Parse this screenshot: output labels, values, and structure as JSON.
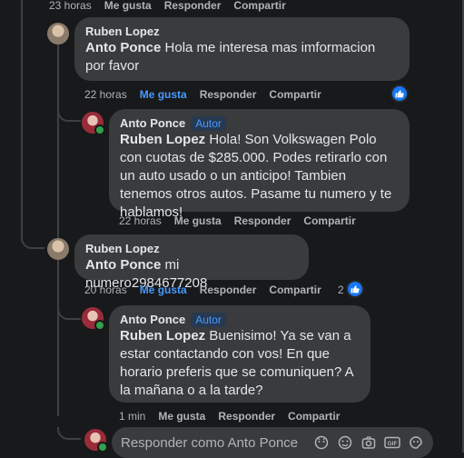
{
  "top_actions": {
    "time": "23 horas",
    "like": "Me gusta",
    "reply": "Responder",
    "share": "Compartir"
  },
  "comments": [
    {
      "author": "Ruben Lopez",
      "mention": "Anto Ponce",
      "text": "Hola me interesa mas imformacion por favor",
      "actions": {
        "time": "22 horas",
        "like": "Me gusta",
        "reply": "Responder",
        "share": "Compartir"
      }
    },
    {
      "author": "Anto Ponce",
      "badge": "Autor",
      "mention": "Ruben Lopez",
      "text": "Hola! Son Volkswagen Polo con cuotas de $285.000. Podes retirarlo con un auto usado o un anticipo! Tambien tenemos otros autos. Pasame tu numero y te hablamos!",
      "actions": {
        "time": "22 horas",
        "like": "Me gusta",
        "reply": "Responder",
        "share": "Compartir"
      }
    },
    {
      "author": "Ruben Lopez",
      "mention": "Anto Ponce",
      "text": "mi numero2984677208",
      "actions": {
        "time": "20 horas",
        "like": "Me gusta",
        "reply": "Responder",
        "share": "Compartir"
      },
      "reactions": "2"
    },
    {
      "author": "Anto Ponce",
      "badge": "Autor",
      "mention": "Ruben Lopez",
      "text": "Buenisimo! Ya se van a estar contactando con vos! En que horario preferis que se comuniquen? A la mañana o a la tarde?",
      "actions": {
        "time": "1 min",
        "like": "Me gusta",
        "reply": "Responder",
        "share": "Compartir"
      }
    }
  ],
  "reply_box": {
    "placeholder": "Responder como Anto Ponce"
  },
  "colors": {
    "accent": "#4599ff",
    "like_blue": "#1877f2",
    "bubble": "#3a3b3c",
    "background": "#18191a"
  }
}
